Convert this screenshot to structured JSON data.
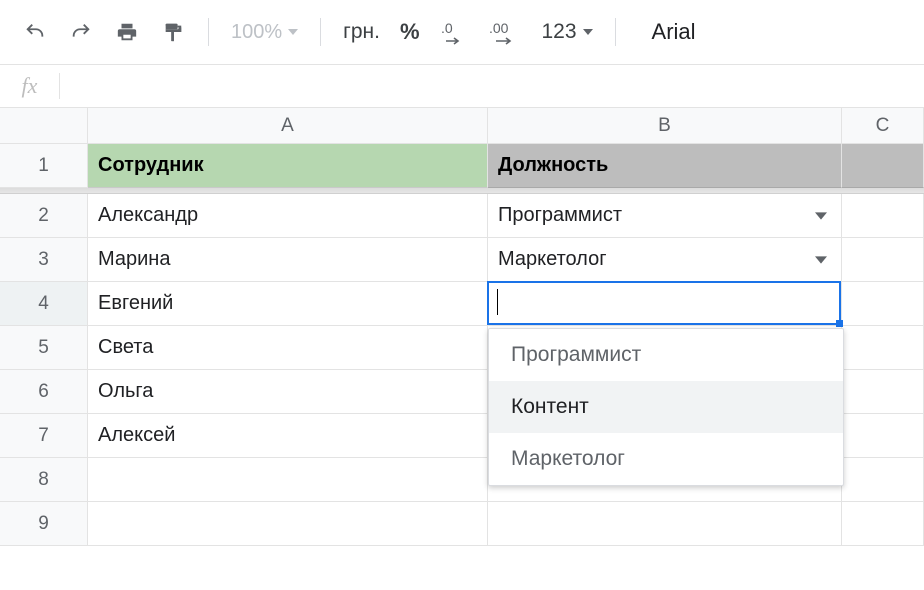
{
  "toolbar": {
    "zoom_label": "100%",
    "currency_label": "грн.",
    "percent_label": "%",
    "dec_decrease_label": ".0",
    "dec_increase_label": ".00",
    "more_formats_label": "123",
    "font_label": "Arial"
  },
  "formula_bar": {
    "fx_label": "fx",
    "value": ""
  },
  "headers": {
    "columns": [
      "A",
      "B",
      "C"
    ],
    "rows": [
      "1",
      "2",
      "3",
      "4",
      "5",
      "6",
      "7",
      "8",
      "9"
    ]
  },
  "sheet": {
    "header_row": {
      "a": "Сотрудник",
      "b": "Должность"
    },
    "rows": {
      "r2": {
        "a": "Александр",
        "b": "Программист"
      },
      "r3": {
        "a": "Марина",
        "b": "Маркетолог"
      },
      "r4": {
        "a": "Евгений",
        "b": ""
      },
      "r5": {
        "a": "Света",
        "b": ""
      },
      "r6": {
        "a": "Ольга",
        "b": ""
      },
      "r7": {
        "a": "Алексей",
        "b": ""
      }
    }
  },
  "dropdown": {
    "options": [
      "Программист",
      "Контент",
      "Маркетолог"
    ],
    "highlighted_index": 1
  }
}
